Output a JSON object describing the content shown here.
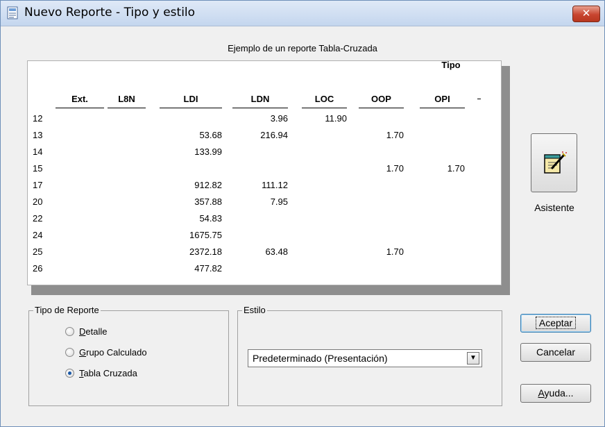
{
  "window": {
    "title": "Nuevo Reporte - Tipo y estilo",
    "close_label": "✕"
  },
  "preview": {
    "caption": "Ejemplo de un reporte Tabla-Cruzada",
    "top_label": "Tipo",
    "headers": [
      "Ext.",
      "L8N",
      "LDI",
      "LDN",
      "LOC",
      "OOP",
      "OPI"
    ],
    "stray_mark": "-",
    "rows": [
      [
        "12",
        "",
        "",
        "3.96",
        "11.90",
        "",
        ""
      ],
      [
        "13",
        "",
        "53.68",
        "216.94",
        "",
        "1.70",
        ""
      ],
      [
        "14",
        "",
        "133.99",
        "",
        "",
        "",
        ""
      ],
      [
        "15",
        "",
        "",
        "",
        "",
        "1.70",
        "1.70"
      ],
      [
        "17",
        "",
        "912.82",
        "111.12",
        "",
        "",
        ""
      ],
      [
        "20",
        "",
        "357.88",
        "7.95",
        "",
        "",
        ""
      ],
      [
        "22",
        "",
        "54.83",
        "",
        "",
        "",
        ""
      ],
      [
        "24",
        "",
        "1675.75",
        "",
        "",
        "",
        ""
      ],
      [
        "25",
        "",
        "2372.18",
        "63.48",
        "",
        "1.70",
        ""
      ],
      [
        "26",
        "",
        "477.82",
        "",
        "",
        "",
        ""
      ]
    ]
  },
  "report_type": {
    "legend": "Tipo de Reporte",
    "options": [
      {
        "key": "D",
        "rest": "etalle",
        "checked": false
      },
      {
        "key": "G",
        "rest": "rupo Calculado",
        "checked": false
      },
      {
        "key": "T",
        "rest": "abla Cruzada",
        "checked": true
      }
    ]
  },
  "style": {
    "legend": "Estilo",
    "selected": "Predeterminado (Presentación)"
  },
  "buttons": {
    "wizard_label": "Asistente",
    "accept": "Aceptar",
    "cancel": "Cancelar",
    "help_key": "A",
    "help_rest": "yuda..."
  }
}
